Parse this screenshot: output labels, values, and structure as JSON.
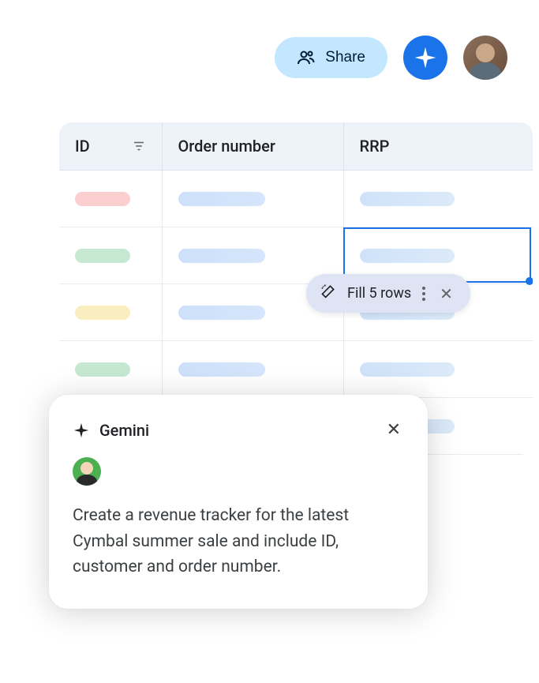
{
  "topbar": {
    "share_label": "Share"
  },
  "table": {
    "columns": {
      "id": "ID",
      "order_number": "Order number",
      "rrp": "RRP"
    }
  },
  "fill_chip": {
    "label": "Fill 5 rows"
  },
  "gemini_panel": {
    "title": "Gemini",
    "prompt": "Create a revenue tracker for the latest Cymbal summer sale and include ID, customer and order number."
  }
}
